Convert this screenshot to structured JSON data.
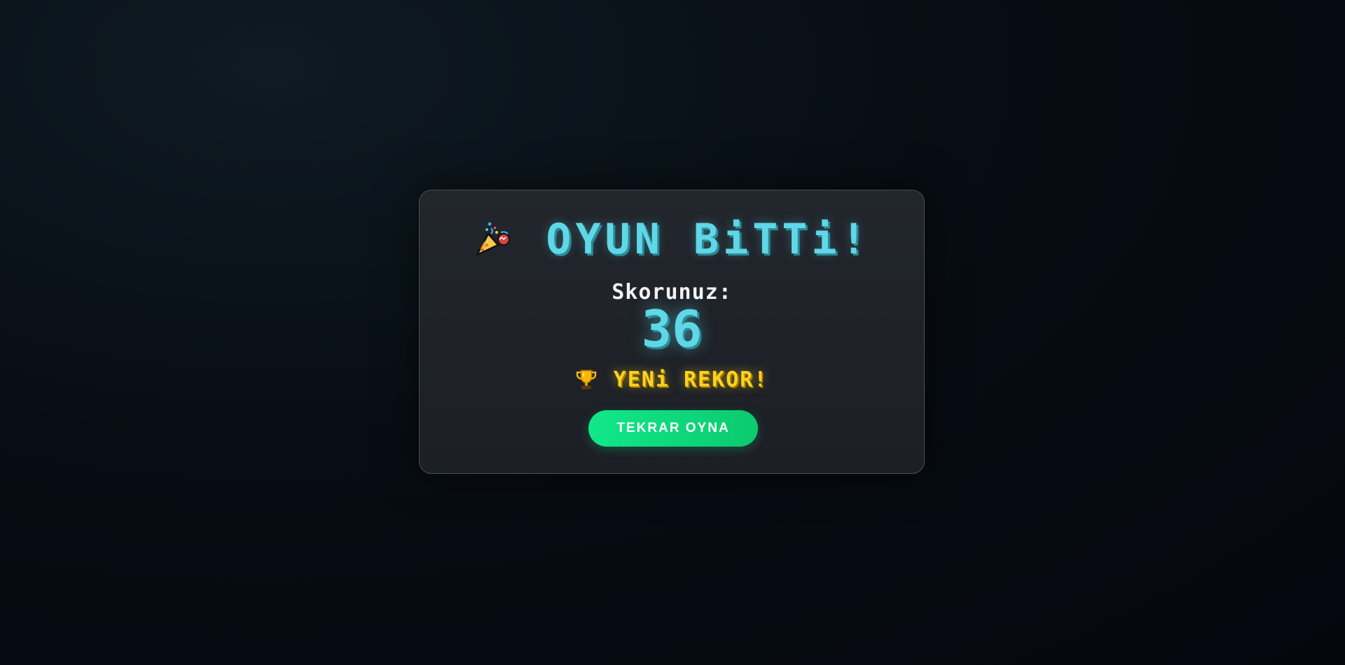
{
  "game_over": {
    "title": "OYUN BiTTi!",
    "score_label": "Skorunuz:",
    "score_value": "36",
    "record_text": "YENi REKOR!",
    "play_again_label": "TEKRAR OYNA",
    "icons": {
      "title_icon": "party-popper-icon",
      "record_icon": "trophy-icon"
    },
    "colors": {
      "accent": "#5fd7e6",
      "record": "#ffd21f",
      "button": "#10e88a"
    }
  }
}
